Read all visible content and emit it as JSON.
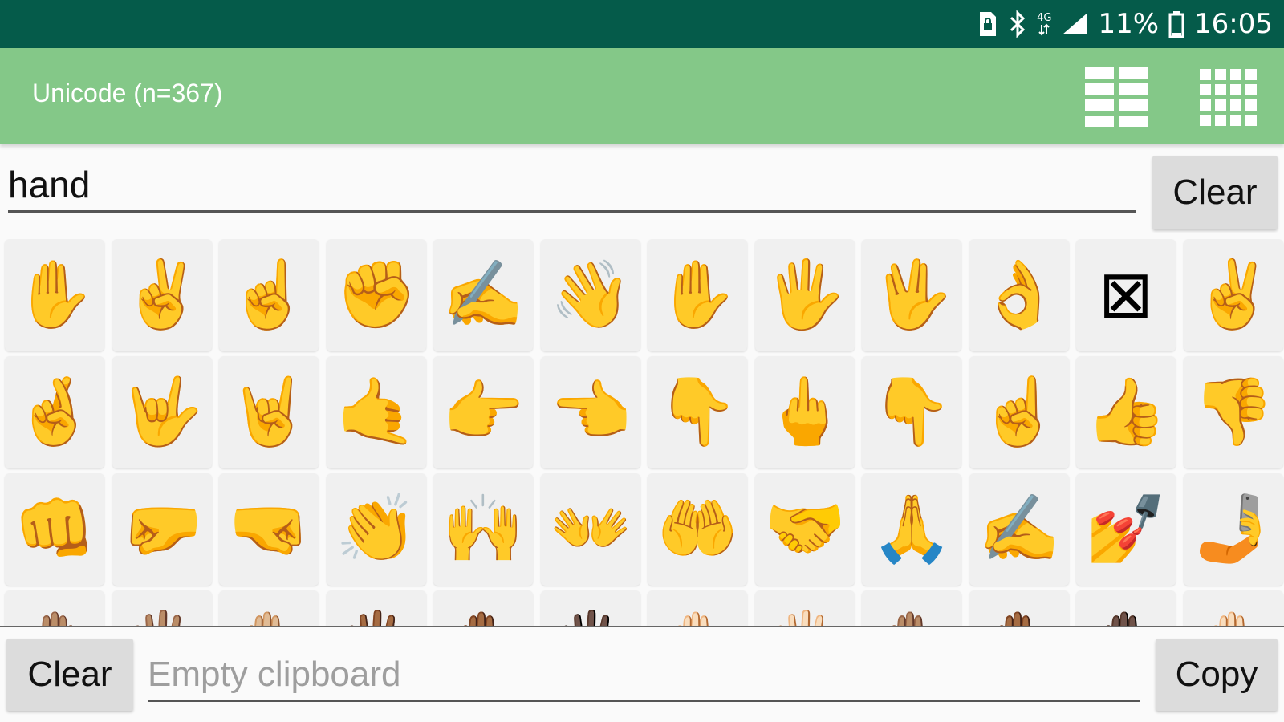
{
  "status_bar": {
    "battery_percent": "11%",
    "time": "16:05",
    "network_label": "4G",
    "icons": [
      "sim-lock-icon",
      "bluetooth-icon",
      "network-4g-icon",
      "signal-icon",
      "battery-icon"
    ]
  },
  "app_bar": {
    "title": "Unicode (n=367)",
    "actions": [
      {
        "name": "list-view-button",
        "icon": "list-grid-icon"
      },
      {
        "name": "grid-view-button",
        "icon": "dense-grid-icon"
      }
    ]
  },
  "search": {
    "value": "hand",
    "clear_label": "Clear"
  },
  "emoji_grid": {
    "rows": [
      [
        "✋",
        "✌️",
        "☝️",
        "✊",
        "✍️",
        "👋",
        "✋",
        "🖐️",
        "🖖",
        "👌",
        "⊠",
        "✌️"
      ],
      [
        "🤞",
        "🤟",
        "🤘",
        "🤙",
        "👉",
        "👈",
        "👇",
        "🖕",
        "👇",
        "☝️",
        "👍",
        "👎"
      ],
      [
        "👊",
        "🤛",
        "🤜",
        "👏",
        "🙌",
        "👐",
        "🤲",
        "🤝",
        "🙏",
        "✍️",
        "💅",
        "🤳"
      ],
      [
        "🤚🏽",
        "🖐🏽",
        "✋🏼",
        "🖐🏾",
        "✋🏾",
        "🖐🏿",
        "✋🏻",
        "🖐🏻",
        "✋🏽",
        "✋🏾",
        "✋🏿",
        "✋🏻"
      ]
    ]
  },
  "clipboard": {
    "clear_label": "Clear",
    "placeholder": "Empty clipboard",
    "copy_label": "Copy"
  },
  "colors": {
    "status_bar": "#055b4a",
    "app_bar": "#84c888",
    "button": "#dcdcdc",
    "cell": "#f0f0f0"
  }
}
